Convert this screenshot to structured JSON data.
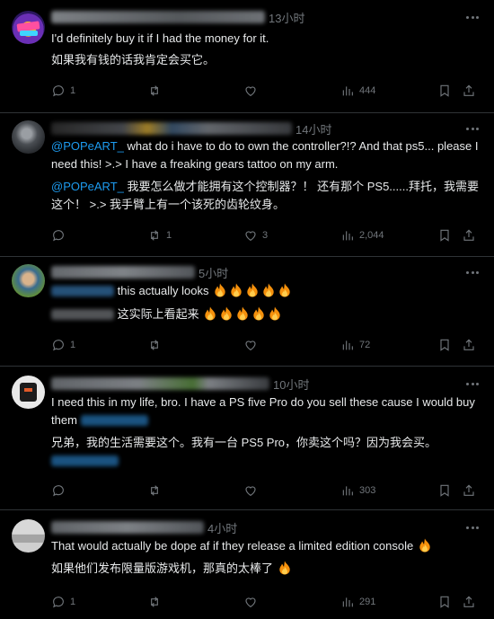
{
  "tweets": [
    {
      "time": "13小时",
      "en": "I'd definitely buy it if I had the money for it.",
      "zh": "如果我有钱的话我肯定会买它。",
      "replies": "1",
      "retweets": "",
      "likes": "",
      "views": "444"
    },
    {
      "time": "14小时",
      "mention": "@POPeART_",
      "en_rest": " what do i have to do to own the controller?!? And that ps5... please I need this!  >.> I have a freaking gears tattoo on my arm.",
      "zh_rest": " 我要怎么做才能拥有这个控制器？！ 还有那个 PS5......拜托，我需要这个！ >.> 我手臂上有一个该死的齿轮纹身。",
      "replies": "",
      "retweets": "1",
      "likes": "3",
      "views": "2,044"
    },
    {
      "time": "5小时",
      "en": "this actually looks",
      "zh": "这实际上看起来",
      "replies": "1",
      "retweets": "",
      "likes": "",
      "views": "72"
    },
    {
      "time": "10小时",
      "en": "I need this in my life, bro. I have a PS five Pro do you sell these cause I would buy them",
      "zh": "兄弟，我的生活需要这个。我有一台 PS5 Pro，你卖这个吗？因为我会买。",
      "replies": "",
      "retweets": "",
      "likes": "",
      "views": "303"
    },
    {
      "time": "4小时",
      "en": "That would actually be dope af if they release a limited edition console",
      "zh": "如果他们发布限量版游戏机，那真的太棒了",
      "replies": "1",
      "retweets": "",
      "likes": "",
      "views": "291"
    }
  ],
  "colors": {
    "background": "#000000",
    "text": "#e7e9ea",
    "muted": "#71767b",
    "mention": "#1d9bf0",
    "divider": "#2f3336"
  },
  "icons": [
    "reply-icon",
    "retweet-icon",
    "like-icon",
    "views-icon",
    "bookmark-icon",
    "share-icon",
    "more-icon",
    "fire-emoji"
  ]
}
